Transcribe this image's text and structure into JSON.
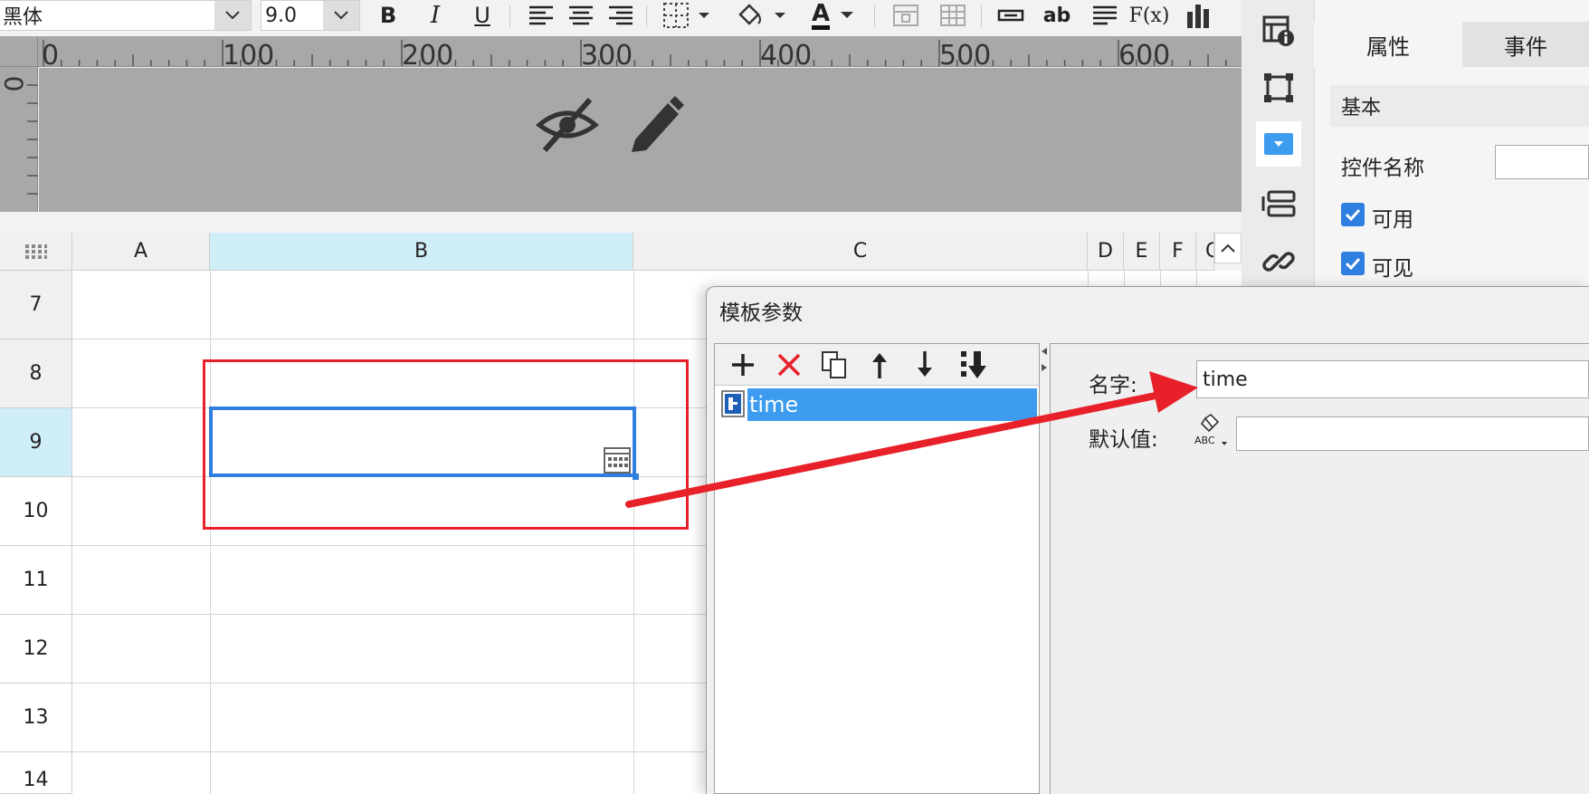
{
  "toolbar": {
    "font_name": "黑体",
    "font_size": "9.0",
    "bold_label": "B",
    "italic_label": "I",
    "underline_label": "U",
    "font_color_label": "A",
    "wrap_label": "ab",
    "formula_label": "F(x)"
  },
  "ruler": {
    "h_marks": [
      "0",
      "100",
      "200",
      "300",
      "400",
      "500",
      "600"
    ],
    "v_mark": "0"
  },
  "grid": {
    "columns": [
      "A",
      "B",
      "C",
      "D",
      "E",
      "F",
      "G"
    ],
    "rows": [
      "7",
      "8",
      "9",
      "10",
      "11",
      "12",
      "13",
      "14"
    ],
    "selected_column": "B",
    "selected_row": "9"
  },
  "properties": {
    "tabs": [
      "属性",
      "事件"
    ],
    "section_title": "基本",
    "control_name_label": "控件名称",
    "control_name_value": "",
    "enabled_label": "可用",
    "visible_label": "可见"
  },
  "dialog": {
    "title": "模板参数",
    "params": [
      "time"
    ],
    "name_label": "名字:",
    "name_value": "time",
    "default_label": "默认值:",
    "default_value": ""
  },
  "colors": {
    "accent": "#3d9cf0",
    "annotation_red": "#e8202a",
    "selection_blue": "#2f7fe0"
  }
}
